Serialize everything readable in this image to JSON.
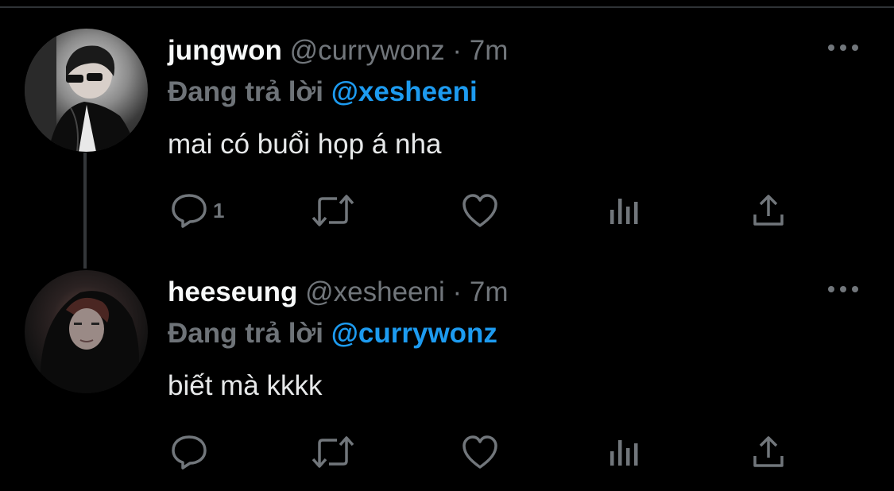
{
  "tweets": [
    {
      "name": "jungwon",
      "handle": "@currywonz",
      "separator": "·",
      "time": "7m",
      "reply_prefix": "Đang trả lời",
      "reply_to": "@xesheeni",
      "text": "mai có buổi họp á nha",
      "reply_count": "1",
      "icons": [
        "reply-icon",
        "retweet-icon",
        "like-icon",
        "analytics-icon",
        "share-icon",
        "more-icon"
      ]
    },
    {
      "name": "heeseung",
      "handle": "@xesheeni",
      "separator": "·",
      "time": "7m",
      "reply_prefix": "Đang trả lời",
      "reply_to": "@currywonz",
      "text": "biết mà kkkk",
      "reply_count": "",
      "icons": [
        "reply-icon",
        "retweet-icon",
        "like-icon",
        "analytics-icon",
        "share-icon",
        "more-icon"
      ]
    }
  ],
  "colors": {
    "background": "#000000",
    "text": "#e7e9ea",
    "secondary": "#71767b",
    "accent": "#1d9bf0",
    "divider": "#2f3336"
  }
}
